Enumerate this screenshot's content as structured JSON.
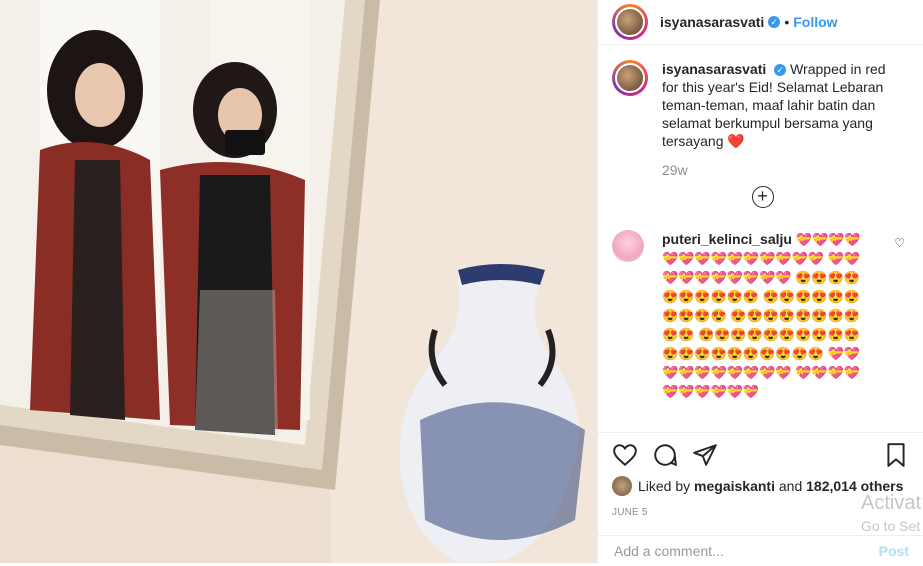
{
  "post": {
    "username": "isyanasarasvati",
    "follow_label": "Follow",
    "dot": "•",
    "verified_mark": "✓",
    "caption": "Wrapped in red for this year's Eid! Selamat Lebaran teman-teman, maaf lahir batin dan selamat berkumpul bersama yang tersayang ❤️",
    "time_ago": "29w",
    "load_more_icon": "+"
  },
  "comment": {
    "username": "puteri_kelinci_salju",
    "emoji_text": "💝💝💝💝 💝💝💝💝💝💝💝💝💝💝 💝💝💝💝💝💝💝💝💝💝 😍😍😍😍😍😍😍😍😍😍 😍😍😍😍😍😍😍😍😍😍 😍😍😍😍😍😍😍😍😍😍 😍😍😍😍😍😍😍😍😍😍 😍😍😍😍😍😍😍😍😍😍 💝💝💝💝💝💝💝💝💝💝 💝💝💝💝💝💝💝💝💝💝",
    "like_icon": "♡"
  },
  "likes": {
    "prefix": "Liked by",
    "user": "megaiskanti",
    "and": "and",
    "count": "182,014 others"
  },
  "date": "JUNE 5",
  "add_comment": {
    "placeholder": "Add a comment...",
    "post_label": "Post"
  },
  "overlay": {
    "line1": "Activat",
    "line2": "Go to Set"
  },
  "icons": {
    "like": "heart-icon",
    "comment": "comment-icon",
    "share": "share-icon",
    "save": "bookmark-icon"
  }
}
